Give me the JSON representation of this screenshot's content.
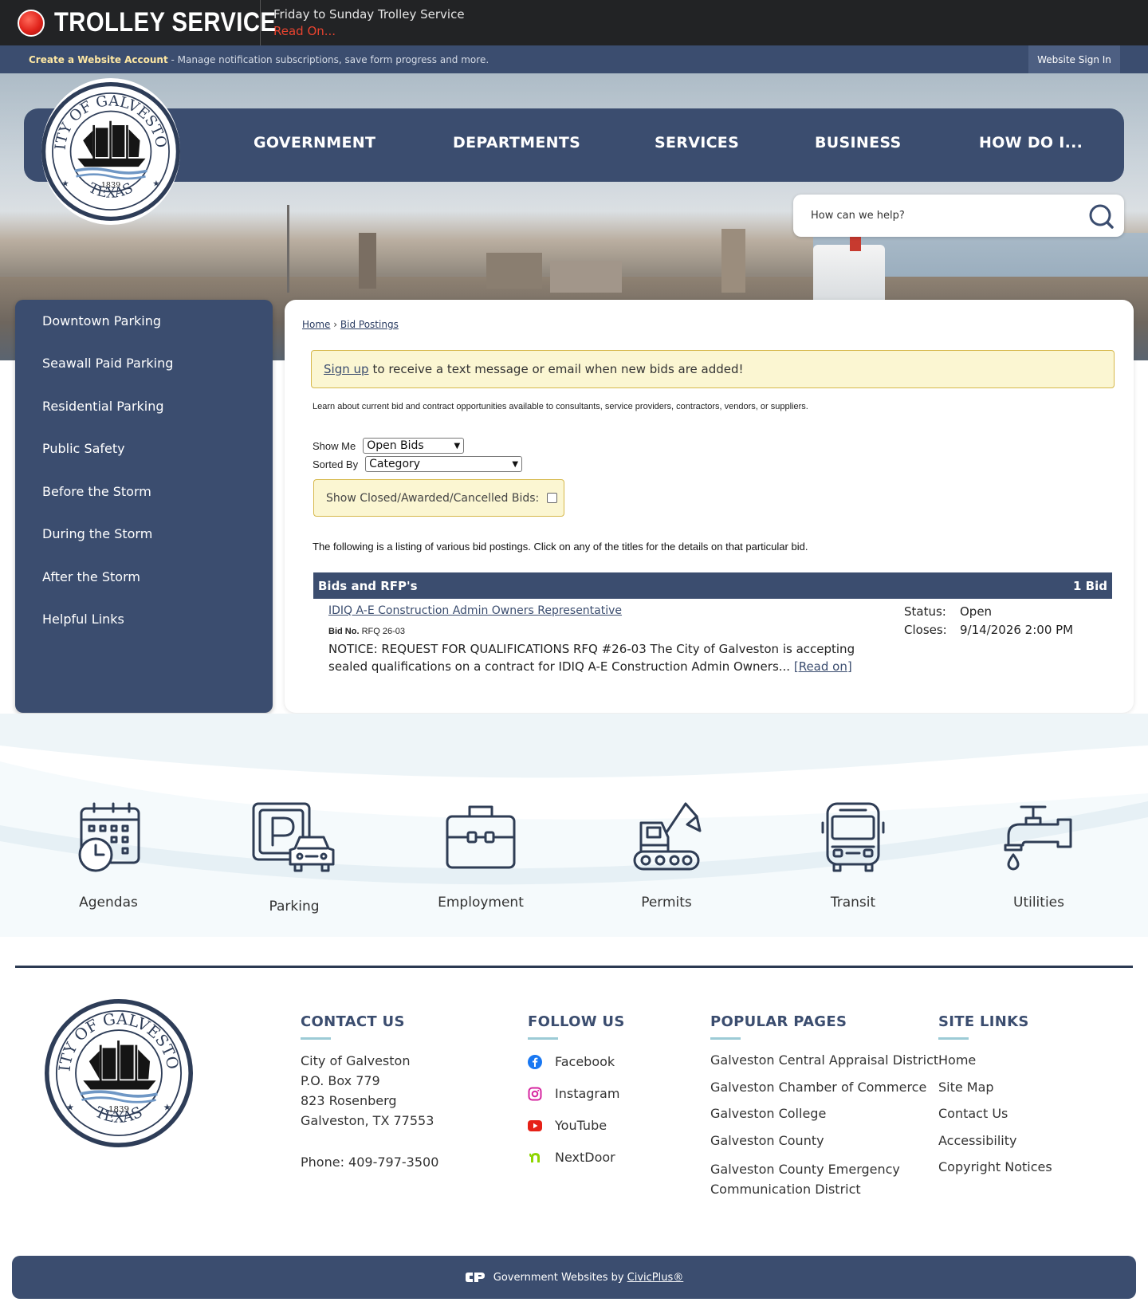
{
  "alert": {
    "title": "TROLLEY SERVICE",
    "headline": "Friday to Sunday Trolley Service",
    "read_on": "Read On..."
  },
  "account": {
    "create_link": "Create a Website Account",
    "description": " - Manage notification subscriptions, save form progress and more.",
    "sign_in": "Website Sign In"
  },
  "nav": {
    "items": [
      "GOVERNMENT",
      "DEPARTMENTS",
      "SERVICES",
      "BUSINESS",
      "HOW DO I..."
    ]
  },
  "seal": {
    "top_text": "CITY OF GALVESTON",
    "year": "1839",
    "bottom_text": "TEXAS"
  },
  "search": {
    "placeholder": "How can we help?"
  },
  "sidebar": {
    "items": [
      "Downtown Parking",
      "Seawall Paid Parking",
      "Residential Parking",
      "Public Safety",
      "Before the Storm",
      "During the Storm",
      "After the Storm",
      "Helpful Links"
    ]
  },
  "content": {
    "breadcrumb": {
      "home": "Home",
      "separator": "›",
      "current": "Bid Postings"
    },
    "signup": {
      "link": "Sign up",
      "text": "to receive a text message or email when new bids are added!"
    },
    "learn_text": "Learn about current bid and contract opportunities available to consultants, service providers, contractors, vendors, or suppliers.",
    "show_me": {
      "label": "Show Me",
      "value": "Open Bids"
    },
    "sorted_by": {
      "label": "Sorted By",
      "value": "Category"
    },
    "closed_label": "Show Closed/Awarded/Cancelled Bids:",
    "listing_text": "The following is a listing of various bid postings. Click on any of the titles for the details on that particular bid.",
    "bids_section": {
      "title": "Bids and RFP's",
      "count": "1 Bid",
      "bid": {
        "title": "IDIQ A-E Construction Admin Owners Representative",
        "bid_no_label": "Bid No.",
        "bid_no": "RFQ 26-03",
        "description": "NOTICE: REQUEST FOR QUALIFICATIONS RFQ #26-03 The City of Galveston is accepting sealed qualifications on a contract for IDIQ A-E Construction Admin Owners...",
        "read_on": "[Read on]",
        "status_label": "Status:",
        "status": "Open",
        "closes_label": "Closes:",
        "closes": "9/14/2026 2:00 PM"
      }
    }
  },
  "quick_links": [
    "Agendas",
    "Parking",
    "Employment",
    "Permits",
    "Transit",
    "Utilities"
  ],
  "footer": {
    "contact": {
      "heading": "CONTACT US",
      "lines": [
        "City of Galveston",
        "P.O. Box 779",
        "823 Rosenberg",
        "Galveston, TX 77553"
      ],
      "phone": "Phone: 409-797-3500"
    },
    "follow": {
      "heading": "FOLLOW US",
      "items": [
        "Facebook",
        "Instagram",
        "YouTube",
        "NextDoor"
      ]
    },
    "popular": {
      "heading": "POPULAR PAGES",
      "items": [
        "Galveston Central Appraisal District",
        "Galveston Chamber of Commerce",
        "Galveston College",
        "Galveston County",
        "Galveston County Emergency",
        "Communication District"
      ]
    },
    "site_links": {
      "heading": "SITE LINKS",
      "items": [
        "Home",
        "Site Map",
        "Contact Us",
        "Accessibility",
        "Copyright Notices"
      ]
    },
    "civic": {
      "text": "Government Websites by",
      "link": "CivicPlus®"
    }
  },
  "colors": {
    "navy": "#3b4d6f",
    "alert_red": "#e8432f",
    "highlight": "#fbf6d2",
    "accent_yellow": "#ffe8a3"
  }
}
